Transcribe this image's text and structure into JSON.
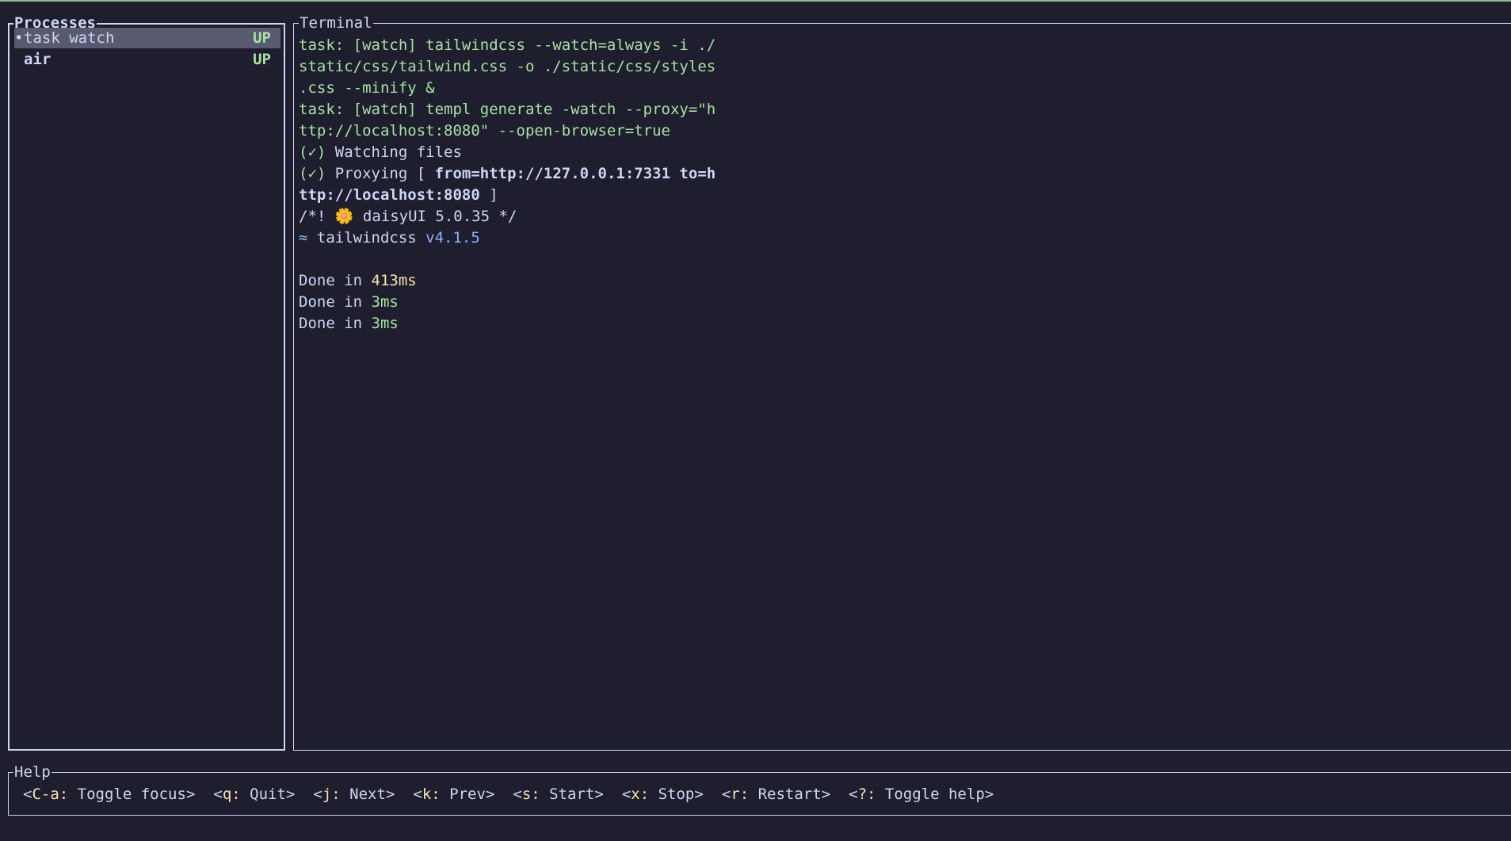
{
  "processes": {
    "title": "Processes",
    "items": [
      {
        "bullet": "•",
        "name": "task watch",
        "status": "UP"
      },
      {
        "bullet": "",
        "name": "air",
        "status": "UP"
      }
    ]
  },
  "terminal": {
    "title": "Terminal",
    "lines": [
      [
        {
          "text": "task: [watch] tailwindcss --watch=always -i ./",
          "style": "g"
        }
      ],
      [
        {
          "text": "static/css/tailwind.css -o ./static/css/styles",
          "style": "g"
        }
      ],
      [
        {
          "text": ".css --minify &",
          "style": "g"
        }
      ],
      [
        {
          "text": "task: [watch] templ generate -watch --proxy=\"h",
          "style": "g"
        }
      ],
      [
        {
          "text": "ttp://localhost:8080\" --open-browser=true",
          "style": "g"
        }
      ],
      [
        {
          "text": "(✓)",
          "style": "g"
        },
        {
          "text": " Watching files",
          "style": "w"
        }
      ],
      [
        {
          "text": "(✓)",
          "style": "g"
        },
        {
          "text": " Proxying [ ",
          "style": "w"
        },
        {
          "text": "from=http://127.0.0.1:7331 to=h",
          "style": "w b"
        }
      ],
      [
        {
          "text": "ttp://localhost:8080",
          "style": "w b"
        },
        {
          "text": " ]",
          "style": "w"
        }
      ],
      [
        {
          "text": "/*! ",
          "style": "w"
        },
        {
          "text": "🌼",
          "style": "daisy"
        },
        {
          "text": " daisyUI 5.0.35 */",
          "style": "w"
        }
      ],
      [
        {
          "text": "≈ ",
          "style": "blue"
        },
        {
          "text": "tailwindcss ",
          "style": "w"
        },
        {
          "text": "v4.1.5",
          "style": "blue"
        }
      ],
      [
        {
          "text": "",
          "style": "w"
        }
      ],
      [
        {
          "text": "Done in ",
          "style": "w"
        },
        {
          "text": "413ms",
          "style": "y"
        }
      ],
      [
        {
          "text": "Done in ",
          "style": "w"
        },
        {
          "text": "3ms",
          "style": "g"
        }
      ],
      [
        {
          "text": "Done in ",
          "style": "w"
        },
        {
          "text": "3ms",
          "style": "g"
        }
      ]
    ]
  },
  "help": {
    "title": "Help",
    "hints": [
      {
        "key": "C-a:",
        "label": "Toggle focus"
      },
      {
        "key": "q:",
        "label": "Quit"
      },
      {
        "key": "j:",
        "label": "Next"
      },
      {
        "key": "k:",
        "label": "Prev"
      },
      {
        "key": "s:",
        "label": "Start"
      },
      {
        "key": "x:",
        "label": "Stop"
      },
      {
        "key": "r:",
        "label": "Restart"
      },
      {
        "key": "?:",
        "label": "Toggle help"
      }
    ]
  },
  "colors": {
    "background": "#1e1e2e",
    "foreground": "#cdd6f4",
    "green": "#a6e3a1",
    "yellow": "#f9e2af",
    "blue": "#89b4fa",
    "selection": "#585b70"
  }
}
